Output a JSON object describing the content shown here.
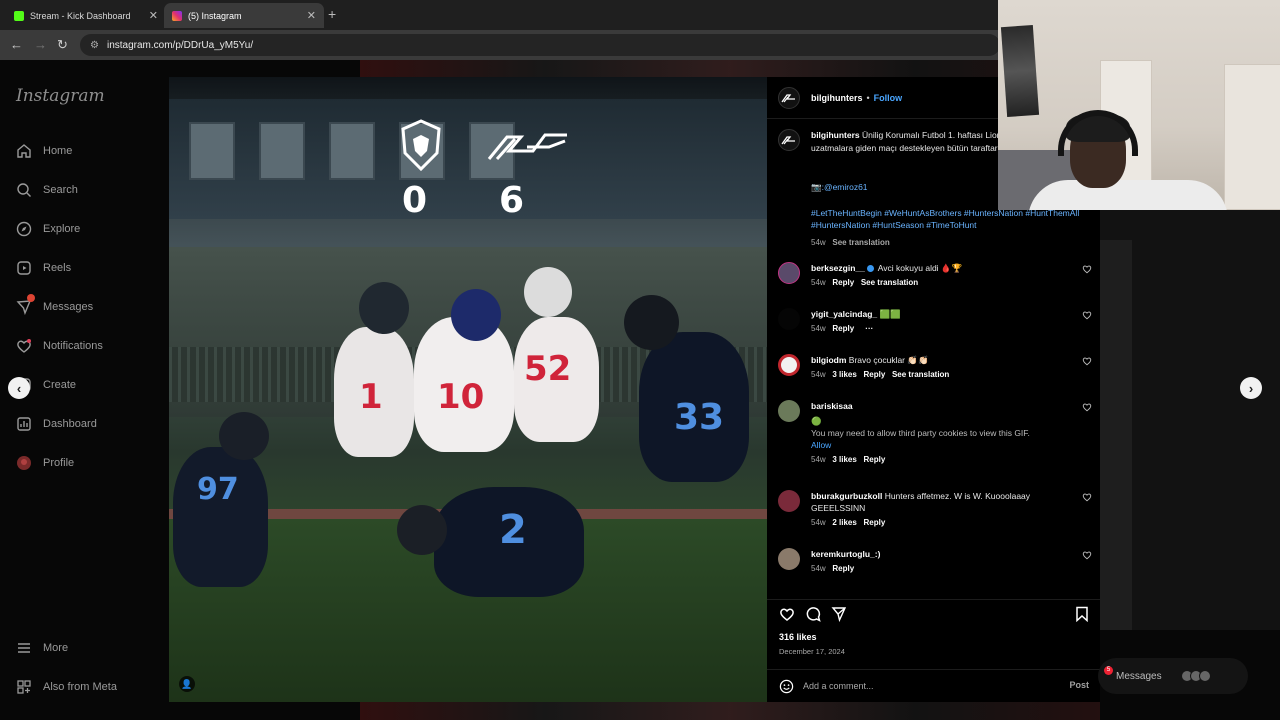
{
  "browser": {
    "tabs": [
      {
        "title": "Stream - Kick Dashboard",
        "favicon_color": "#53fc18"
      },
      {
        "title": "(5) Instagram",
        "favicon_color": "#e1306c"
      }
    ],
    "url": "instagram.com/p/DDrUa_yM5Yu/"
  },
  "sidebar": {
    "logo": "Instagram",
    "items": [
      {
        "label": "Home",
        "icon": "home-icon"
      },
      {
        "label": "Search",
        "icon": "search-icon"
      },
      {
        "label": "Explore",
        "icon": "compass-icon"
      },
      {
        "label": "Reels",
        "icon": "reels-icon"
      },
      {
        "label": "Messages",
        "icon": "messenger-icon",
        "badge": "5"
      },
      {
        "label": "Notifications",
        "icon": "heart-icon"
      },
      {
        "label": "Create",
        "icon": "plus-square-icon"
      },
      {
        "label": "Dashboard",
        "icon": "dashboard-icon"
      },
      {
        "label": "Profile",
        "icon": "avatar-icon"
      }
    ],
    "bottom": [
      {
        "label": "More",
        "icon": "menu-icon"
      },
      {
        "label": "Also from Meta",
        "icon": "meta-icon"
      }
    ]
  },
  "post": {
    "score_home": "0",
    "score_away": "6",
    "jersey_numbers": [
      "97",
      "1",
      "10",
      "52",
      "2",
      "33"
    ],
    "author": "bilgihunters",
    "follow_label": "Follow",
    "caption": "Ünilig Korumalı Futbol 1. haftası Lions ile oynadığımız uzatmalara giden maçı destekleyen bütün taraftarlarımıza teşekkür e",
    "mention": "📷:@emiroz61",
    "hashtags": "#LetTheHuntBegin #WeHuntAsBrothers #HuntersNation #HuntThemAll #HuntersNation #HuntSeason #TimeToHunt",
    "caption_time": "54w",
    "caption_translate": "See translation",
    "likes": "316 likes",
    "date": "December 17, 2024",
    "add_comment_placeholder": "Add a comment...",
    "post_label": "Post"
  },
  "comments": [
    {
      "user": "berksezgin__",
      "verified": true,
      "text": "Avci kokuyu aldi 🩸🏆",
      "time": "54w",
      "likes": "",
      "reply": "Reply",
      "translate": "See translation",
      "avatar_color": "#5a4a6a"
    },
    {
      "user": "yigit_yalcindag_",
      "verified": false,
      "text": "🟩🟩",
      "time": "54w",
      "likes": "",
      "reply": "Reply",
      "translate": "",
      "avatar_color": "#050505"
    },
    {
      "user": "bilgiodm",
      "verified": false,
      "text": "Bravo çocuklar 👏🏻👏🏻",
      "time": "54w",
      "likes": "3 likes",
      "reply": "Reply",
      "translate": "See translation",
      "avatar_color": "#c0262d"
    },
    {
      "user": "bariskisaa",
      "verified": false,
      "text": "🟢",
      "note": "You may need to allow third party cookies to view this GIF.",
      "allow": "Allow",
      "time": "54w",
      "likes": "3 likes",
      "reply": "Reply",
      "translate": "",
      "avatar_color": "#6b7a5a"
    },
    {
      "user": "bburakgurbuzkoll",
      "verified": false,
      "text": "Hunters affetmez. W is W. Kuooolaaay GEEELSSINN",
      "time": "54w",
      "likes": "2 likes",
      "reply": "Reply",
      "translate": "",
      "avatar_color": "#7a2a3a"
    },
    {
      "user": "keremkurtoglu_:)",
      "verified": false,
      "text": "",
      "time": "54w",
      "likes": "",
      "reply": "Reply",
      "translate": "",
      "avatar_color": "#8a7a6a"
    }
  ],
  "messages_pill": {
    "label": "Messages",
    "badge": "5"
  }
}
